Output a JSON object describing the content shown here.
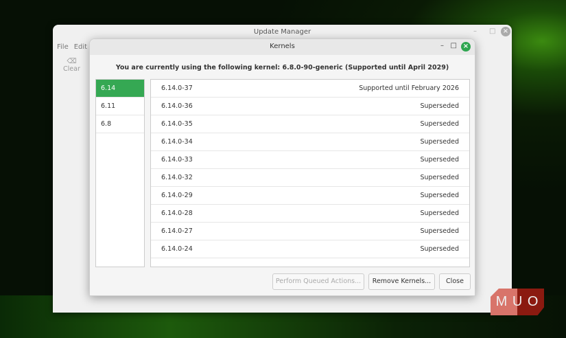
{
  "main_window": {
    "title": "Update Manager",
    "menu": [
      "File",
      "Edit"
    ],
    "clear_label": "Clear"
  },
  "dialog": {
    "title": "Kernels",
    "heading": "You are currently using the following kernel: 6.8.0-90-generic (Supported until April 2029)",
    "series": [
      {
        "label": "6.14",
        "selected": true
      },
      {
        "label": "6.11"
      },
      {
        "label": "6.8"
      }
    ],
    "kernels": [
      {
        "version": "6.14.0-37",
        "status": "Supported until February 2026"
      },
      {
        "version": "6.14.0-36",
        "status": "Superseded"
      },
      {
        "version": "6.14.0-35",
        "status": "Superseded"
      },
      {
        "version": "6.14.0-34",
        "status": "Superseded"
      },
      {
        "version": "6.14.0-33",
        "status": "Superseded"
      },
      {
        "version": "6.14.0-32",
        "status": "Superseded"
      },
      {
        "version": "6.14.0-29",
        "status": "Superseded"
      },
      {
        "version": "6.14.0-28",
        "status": "Superseded"
      },
      {
        "version": "6.14.0-27",
        "status": "Superseded"
      },
      {
        "version": "6.14.0-24",
        "status": "Superseded"
      }
    ],
    "buttons": {
      "perform": "Perform Queued Actions...",
      "remove": "Remove Kernels...",
      "close": "Close"
    }
  },
  "watermark": "MUO",
  "colors": {
    "accent": "#35a853",
    "close": "#2ea650"
  }
}
